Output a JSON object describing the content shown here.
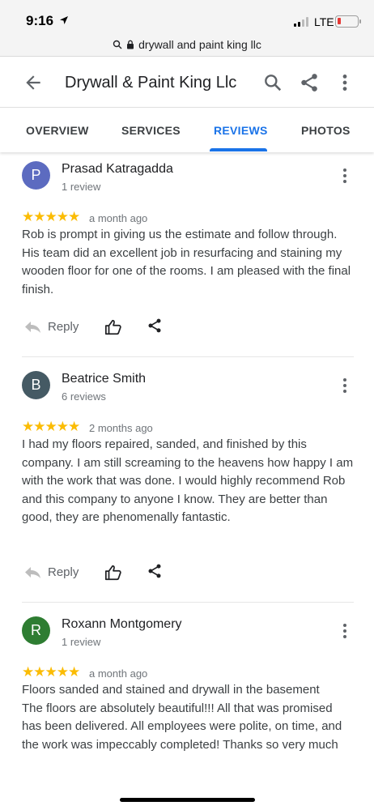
{
  "status_bar": {
    "time": "9:16",
    "network": "LTE",
    "battery_color": "#e53935",
    "location_icon": "location-arrow-icon"
  },
  "browser": {
    "url": "drywall and paint king llc"
  },
  "header": {
    "title": "Drywall & Paint King Llc"
  },
  "tabs": [
    {
      "label": "OVERVIEW",
      "active": false
    },
    {
      "label": "SERVICES",
      "active": false
    },
    {
      "label": "REVIEWS",
      "active": true
    },
    {
      "label": "PHOTOS",
      "active": false
    }
  ],
  "reviews": [
    {
      "initial": "P",
      "avatar_color": "#5c6bc0",
      "name": "Prasad Katragadda",
      "count": "1 review",
      "stars": "★★★★★",
      "rating": 5,
      "time": "a month ago",
      "text": "Rob is prompt in giving us the estimate and follow through. His team did an excellent job in resurfacing and staining my wooden floor for one of the rooms. I am pleased with the final finish.",
      "reply_label": "Reply"
    },
    {
      "initial": "B",
      "avatar_color": "#455a64",
      "name": "Beatrice Smith",
      "count": "6 reviews",
      "stars": "★★★★★",
      "rating": 5,
      "time": "2 months ago",
      "text": "I had my floors repaired, sanded, and finished by this company. I am still screaming to the heavens how happy I am with the work that was done. I would highly recommend Rob and this company to anyone I know. They are better than good, they are phenomenally fantastic.",
      "reply_label": "Reply"
    },
    {
      "initial": "R",
      "avatar_color": "#2e7d32",
      "name": "Roxann Montgomery",
      "count": "1 review",
      "stars": "★★★★★",
      "rating": 5,
      "time": "a month ago",
      "text": "Floors sanded and stained and drywall in the basement\nThe floors are absolutely beautiful!!! All that was promised has been delivered. All employees were polite, on time, and the work was impeccably completed! Thanks so very much"
    }
  ],
  "colors": {
    "accent": "#1a73e8",
    "star": "#fbbc04"
  }
}
